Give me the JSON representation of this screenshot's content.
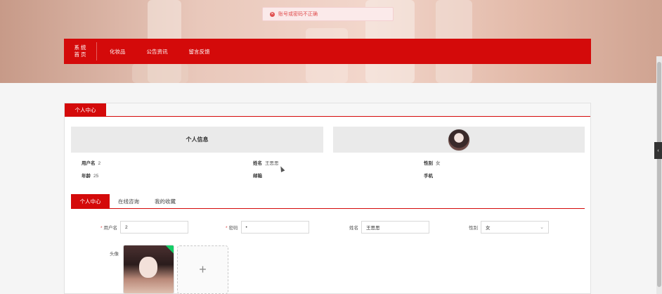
{
  "toast": {
    "message": "账号或密码不正确",
    "icon": "error-circle-icon"
  },
  "nav": {
    "home": [
      "系 统",
      "首 页"
    ],
    "items": [
      "化妆品",
      "公告资讯",
      "留言反馈"
    ]
  },
  "panel": {
    "title": "个人中心",
    "info_title": "个人信息",
    "info": {
      "username_label": "用户名",
      "username_value": "2",
      "name_label": "姓名",
      "name_value": "王思思",
      "gender_label": "性别",
      "gender_value": "女",
      "age_label": "年龄",
      "age_value": "25",
      "email_label": "邮箱",
      "email_value": "",
      "phone_label": "手机",
      "phone_value": ""
    },
    "subtabs": [
      "个人中心",
      "在线咨询",
      "我的收藏"
    ],
    "form": {
      "username_label": "用户名",
      "username_value": "2",
      "password_label": "密码",
      "password_value": "•",
      "name_label": "姓名",
      "name_value": "王思思",
      "gender_label": "性别",
      "gender_value": "女",
      "avatar_label": "头像",
      "add_symbol": "+"
    }
  },
  "side_handle": "‹"
}
